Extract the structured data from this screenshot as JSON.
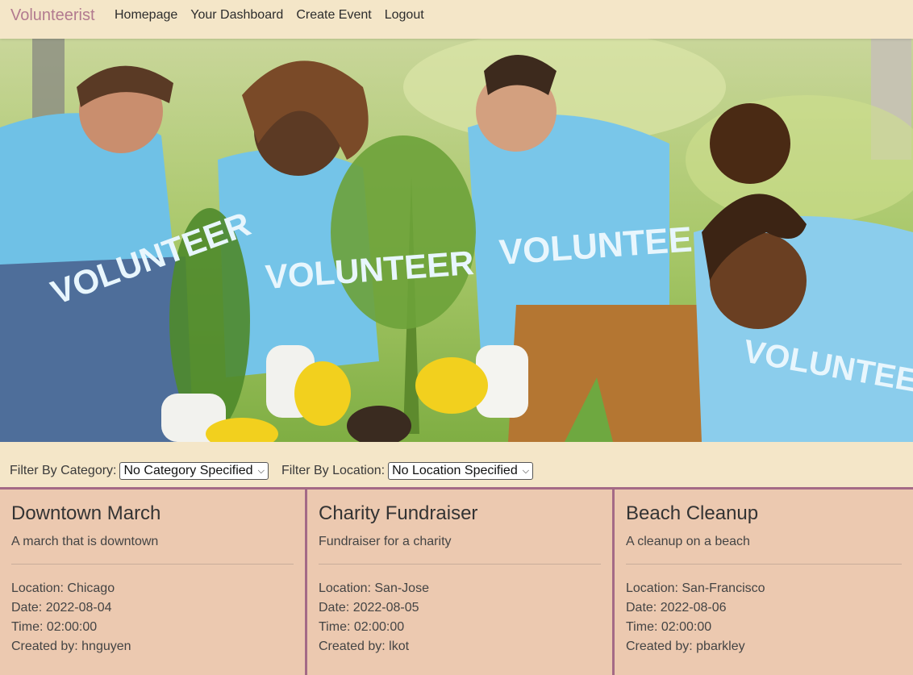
{
  "navbar": {
    "brand": "Volunteerist",
    "links": [
      "Homepage",
      "Your Dashboard",
      "Create Event",
      "Logout"
    ]
  },
  "hero": {
    "shirt_text": "VOLUNTEER"
  },
  "filters": {
    "category_label": "Filter By Category:",
    "category_selected": "No Category Specified",
    "location_label": "Filter By Location:",
    "location_selected": "No Location Specified"
  },
  "events": [
    {
      "title": "Downtown March",
      "description": "A march that is downtown",
      "location": "Location: Chicago",
      "date": "Date: 2022-08-04",
      "time": "Time: 02:00:00",
      "created_by": "Created by: hnguyen"
    },
    {
      "title": "Charity Fundraiser",
      "description": "Fundraiser for a charity",
      "location": "Location: San-Jose",
      "date": "Date: 2022-08-05",
      "time": "Time: 02:00:00",
      "created_by": "Created by: lkot"
    },
    {
      "title": "Beach Cleanup",
      "description": "A cleanup on a beach",
      "location": "Location: San-Francisco",
      "date": "Date: 2022-08-06",
      "time": "Time: 02:00:00",
      "created_by": "Created by: pbarkley"
    }
  ],
  "colors": {
    "background": "#f4e6c8",
    "brand": "#b27a8f",
    "card": "#ecc9b0",
    "card_border": "#a46a86"
  }
}
